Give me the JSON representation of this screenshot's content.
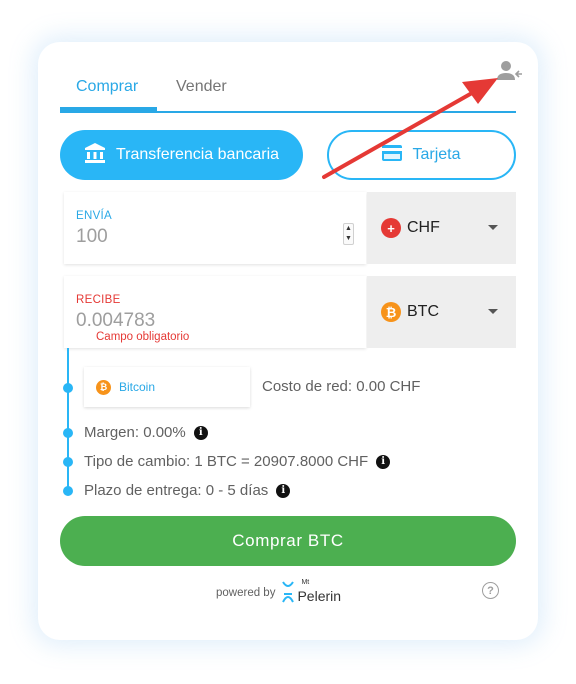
{
  "tabs": [
    {
      "label": "Comprar",
      "active": true
    },
    {
      "label": "Vender",
      "active": false
    }
  ],
  "payment_methods": {
    "bank": {
      "label": "Transferencia bancaria",
      "icon": "bank-icon",
      "selected": true
    },
    "card": {
      "label": "Tarjeta",
      "icon": "credit-card-icon",
      "selected": false
    }
  },
  "send": {
    "label": "ENVÍA",
    "value": "100",
    "currency": "CHF",
    "currency_icon": "swiss-flag-icon"
  },
  "receive": {
    "label": "RECIBE",
    "value": "0.004783",
    "error": "Campo obligatorio",
    "currency": "BTC",
    "currency_icon": "bitcoin-icon"
  },
  "network": {
    "chip_label": "Bitcoin",
    "fee_text": "Costo de red: 0.00 CHF"
  },
  "details": {
    "margin": "Margen: 0.00%",
    "rate": "Tipo de cambio: 1 BTC = 20907.8000 CHF",
    "delivery": "Plazo de entrega: 0 - 5 días"
  },
  "buy_button": "Comprar BTC",
  "footer": {
    "powered_by": "powered by",
    "brand_prefix": "Mt",
    "brand_name": "Pelerin"
  },
  "colors": {
    "accent": "#29b6f6",
    "primary_button": "#4caf50",
    "error": "#e53935",
    "annotation_arrow": "#e53935"
  }
}
